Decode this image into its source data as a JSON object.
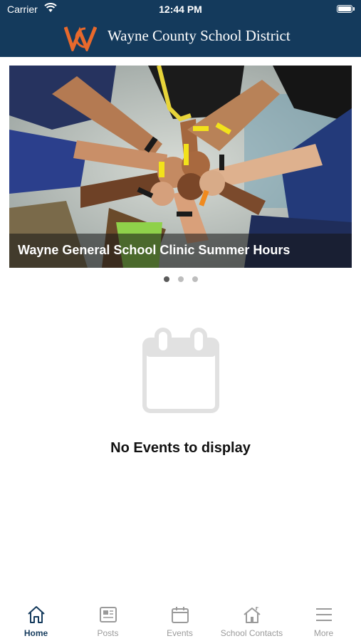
{
  "status_bar": {
    "carrier": "Carrier",
    "time": "12:44 PM"
  },
  "header": {
    "title": "Wayne County School District",
    "logo_text": "WC"
  },
  "carousel": {
    "caption": "Wayne General School Clinic Summer Hours",
    "slide_count": 3,
    "active_slide": 1
  },
  "events": {
    "empty_message": "No Events to display"
  },
  "tabs": [
    {
      "label": "Home",
      "icon": "home-icon",
      "active": true
    },
    {
      "label": "Posts",
      "icon": "newspaper-icon",
      "active": false
    },
    {
      "label": "Events",
      "icon": "calendar-icon",
      "active": false
    },
    {
      "label": "School Contacts",
      "icon": "school-icon",
      "active": false
    },
    {
      "label": "More",
      "icon": "menu-icon",
      "active": false
    }
  ],
  "colors": {
    "header_bg": "#143a5c",
    "logo_accent": "#e8692c",
    "active_tab": "#143a5c",
    "inactive_tab": "#9a9a9a"
  }
}
